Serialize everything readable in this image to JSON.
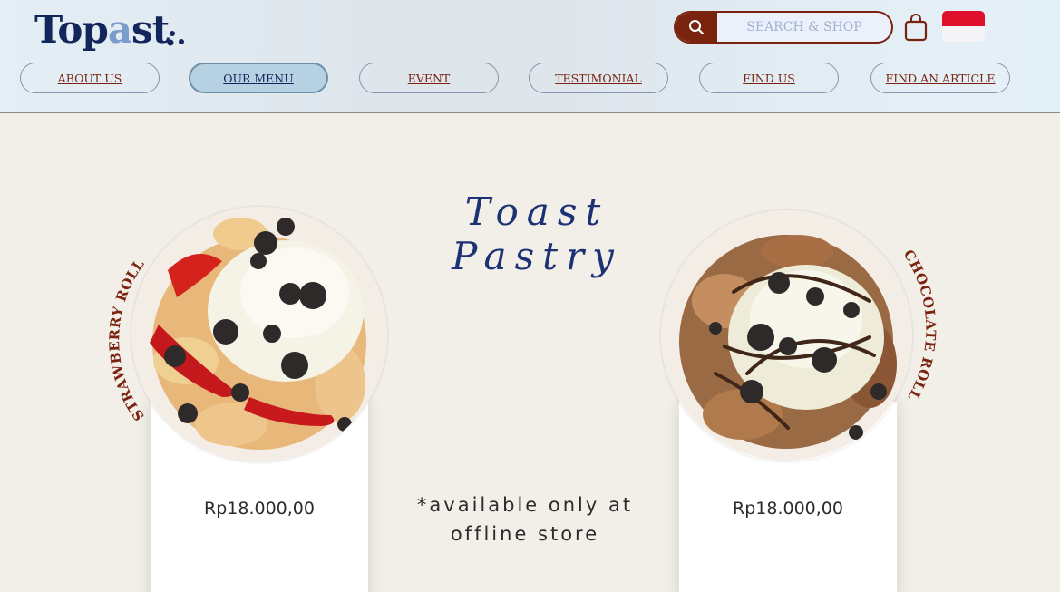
{
  "header": {
    "logo_text_a": "Top",
    "logo_text_b": "a",
    "logo_text_c": "st",
    "search_placeholder": "SEARCH & SHOP",
    "nav": [
      {
        "label": "ABOUT US",
        "active": false
      },
      {
        "label": "OUR MENU",
        "active": true
      },
      {
        "label": "EVENT",
        "active": false
      },
      {
        "label": "TESTIMONIAL",
        "active": false
      },
      {
        "label": "FIND US",
        "active": false
      },
      {
        "label": "FIND AN ARTICLE",
        "active": false
      }
    ]
  },
  "section": {
    "title": "Toast Pastry",
    "note_line1": "*available only at",
    "note_line2": "offline store"
  },
  "products": [
    {
      "name": "STRAWBERRY ROLL",
      "price": "Rp18.000,00"
    },
    {
      "name": "CHOCOLATE ROLL",
      "price": "Rp18.000,00"
    }
  ],
  "colors": {
    "navy": "#13265c",
    "brown": "#7a2410",
    "logo_accent": "#7c9ccb",
    "active_nav": "#b6d2e2",
    "flag_red": "#e0102c"
  },
  "icons": {
    "search": "search-icon",
    "cart": "shopping-bag-icon",
    "language": "indonesia-flag-icon"
  }
}
